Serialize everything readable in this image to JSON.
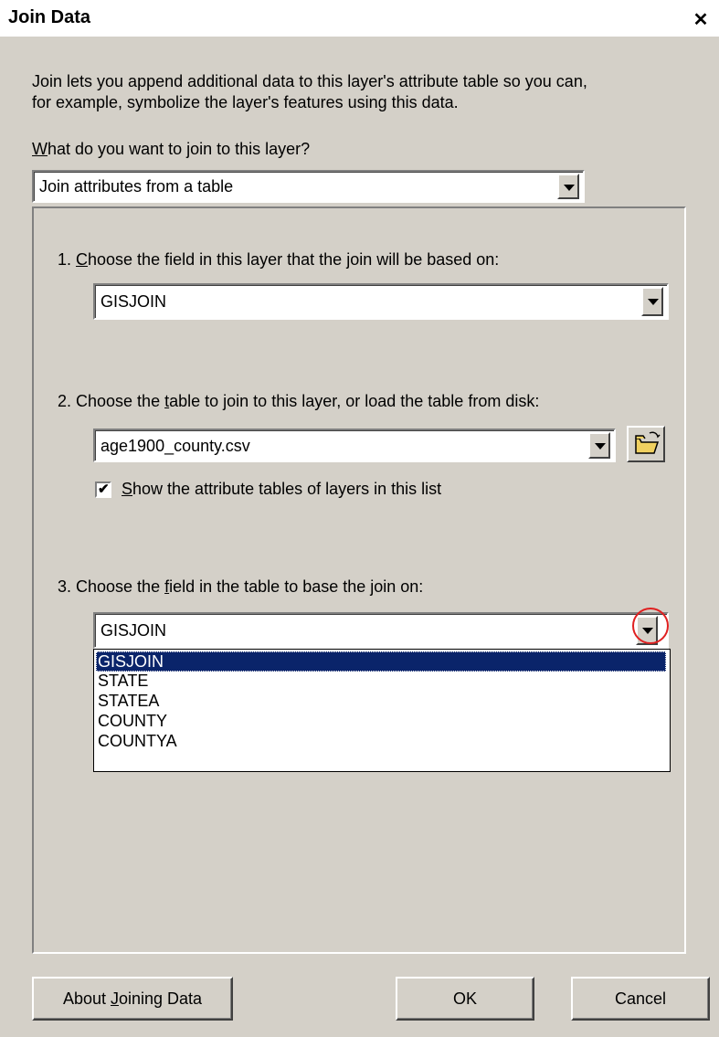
{
  "window": {
    "title": "Join Data",
    "close_glyph": "✕"
  },
  "intro": {
    "line1": "Join lets you append additional data to this layer's attribute table so you can,",
    "line2": "for example, symbolize the layer's features using this data."
  },
  "join_type": {
    "label_prefix": "",
    "label_mnemonic": "W",
    "label_rest": "hat do you want to join to this layer?",
    "selected": "Join attributes from a table"
  },
  "step1": {
    "prefix": "1.  ",
    "mnemonic": "C",
    "rest": "hoose the field in this layer that the join will be based on:",
    "selected": "GISJOIN"
  },
  "step2": {
    "prefix": "2.  Choose the ",
    "mnemonic": "t",
    "rest": "able to join to this layer, or load the table from disk:",
    "selected": "age1900_county.csv",
    "checkbox_mnemonic": "S",
    "checkbox_rest": "how the attribute tables of layers in this list",
    "checkbox_checked": true,
    "browse_icon": "open-folder-icon"
  },
  "step3": {
    "prefix": "3.  Choose the ",
    "mnemonic": "f",
    "rest": "ield in the table to base the join on:",
    "selected": "GISJOIN",
    "options": [
      "GISJOIN",
      "STATE",
      "STATEA",
      "COUNTY",
      "COUNTYA"
    ],
    "selected_index": 0
  },
  "buttons": {
    "about_prefix": "About ",
    "about_mnemonic": "J",
    "about_rest": "oining Data",
    "ok": "OK",
    "cancel": "Cancel"
  },
  "colors": {
    "dialog_bg": "#d4d0c8",
    "selection": "#0a246a",
    "highlight_circle": "#e02020"
  }
}
